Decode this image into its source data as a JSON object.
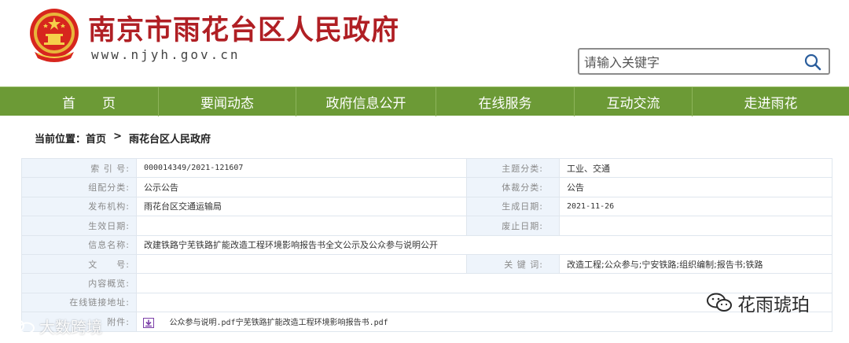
{
  "header": {
    "site_title": "南京市雨花台区人民政府",
    "site_url": "www.njyh.gov.cn"
  },
  "search": {
    "placeholder": "请输入关键字"
  },
  "nav": {
    "items": [
      "首　　页",
      "要闻动态",
      "政府信息公开",
      "在线服务",
      "互动交流",
      "走进雨花"
    ]
  },
  "breadcrumb": {
    "prefix": "当前位置：",
    "home": "首页",
    "separator": "  >  ",
    "current": "雨花台区人民政府"
  },
  "info": {
    "index_label": "索 引 号:",
    "index_value": "000014349/2021-121607",
    "topic_label": "主题分类:",
    "topic_value": "工业、交通",
    "org_label": "组配分类:",
    "org_value": "公示公告",
    "genre_label": "体裁分类:",
    "genre_value": "公告",
    "publisher_label": "发布机构:",
    "publisher_value": "雨花台区交通运输局",
    "created_label": "生成日期:",
    "created_value": "2021-11-26",
    "effective_label": "生效日期:",
    "effective_value": "",
    "abolished_label": "废止日期:",
    "abolished_value": "",
    "name_label": "信息名称:",
    "name_value": "改建铁路宁芜铁路扩能改造工程环境影响报告书全文公示及公众参与说明公开",
    "docno_label": "文　　号:",
    "docno_value": "",
    "keywords_label": "关 键 词:",
    "keywords_value": "改造工程;公众参与;宁安铁路;组织编制;报告书;铁路",
    "summary_label": "内容概览:",
    "summary_value": "",
    "link_label": "在线链接地址:",
    "link_value": "",
    "attachment_label": "附件:",
    "attachment_value": "公众参与说明.pdf宁芜铁路扩能改造工程环境影响报告书.pdf"
  },
  "watermarks": {
    "left": "大数跨境",
    "right": "花雨琥珀"
  },
  "colors": {
    "nav_green": "#6c9a36",
    "title_red": "#b01f24",
    "label_bg": "#eef4fb",
    "attachment_icon": "#7b3fa8"
  }
}
